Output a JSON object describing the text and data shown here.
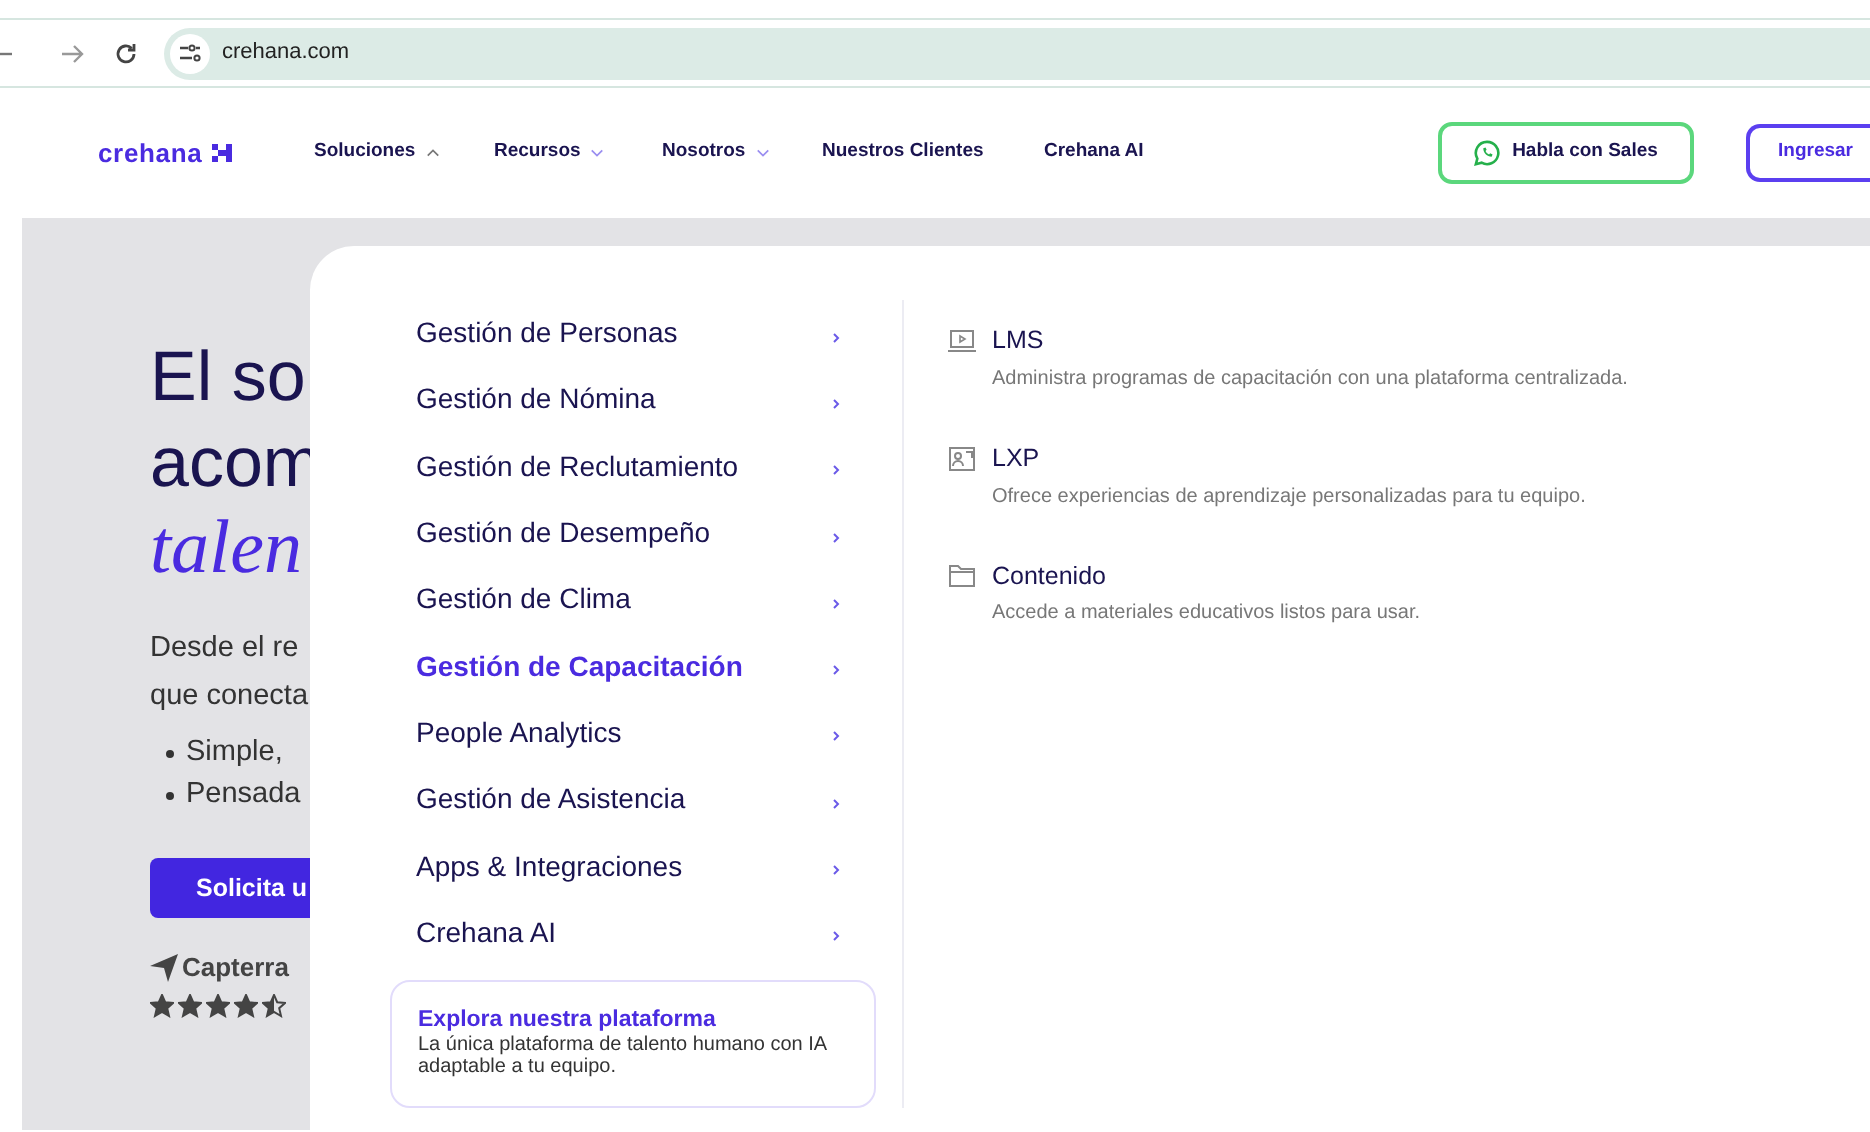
{
  "browser": {
    "url": "crehana.com"
  },
  "nav": {
    "logo": "crehana",
    "items": [
      {
        "label": "Soluciones",
        "kind": "dropdown",
        "expanded": true
      },
      {
        "label": "Recursos",
        "kind": "dropdown",
        "expanded": false
      },
      {
        "label": "Nosotros",
        "kind": "dropdown",
        "expanded": false
      },
      {
        "label": "Nuestros Clientes",
        "kind": "link"
      },
      {
        "label": "Crehana AI",
        "kind": "link"
      }
    ],
    "sales_button": "Habla con Sales",
    "login_button": "Ingresar"
  },
  "hero": {
    "heading_lines": [
      "El so",
      "acom"
    ],
    "heading_accent": "talen",
    "paragraph_lines": [
      "Desde el re",
      "que conecta"
    ],
    "bullets": [
      "Simple,",
      "Pensada"
    ],
    "cta": "Solicita u",
    "review_brand": "Capterra",
    "stars": 4.5
  },
  "menu": {
    "items": [
      {
        "label": "Gestión de Personas",
        "selected": false
      },
      {
        "label": "Gestión de Nómina",
        "selected": false
      },
      {
        "label": "Gestión de Reclutamiento",
        "selected": false
      },
      {
        "label": "Gestión de Desempeño",
        "selected": false
      },
      {
        "label": "Gestión de Clima",
        "selected": false
      },
      {
        "label": "Gestión de Capacitación",
        "selected": true
      },
      {
        "label": "People Analytics",
        "selected": false
      },
      {
        "label": "Gestión de Asistencia",
        "selected": false
      },
      {
        "label": "Apps & Integraciones",
        "selected": false
      },
      {
        "label": "Crehana AI",
        "selected": false
      }
    ],
    "promo": {
      "title": "Explora nuestra plataforma",
      "text": "La única plataforma de talento humano con IA adaptable a tu equipo."
    },
    "submenu": [
      {
        "kind": "lms",
        "title": "LMS",
        "description": "Administra programas de capacitación con una plataforma centralizada."
      },
      {
        "kind": "lxp",
        "title": "LXP",
        "description": "Ofrece experiencias de aprendizaje personalizadas para tu equipo."
      },
      {
        "kind": "content",
        "title": "Contenido",
        "description": "Accede a materiales educativos listos para usar."
      }
    ]
  }
}
